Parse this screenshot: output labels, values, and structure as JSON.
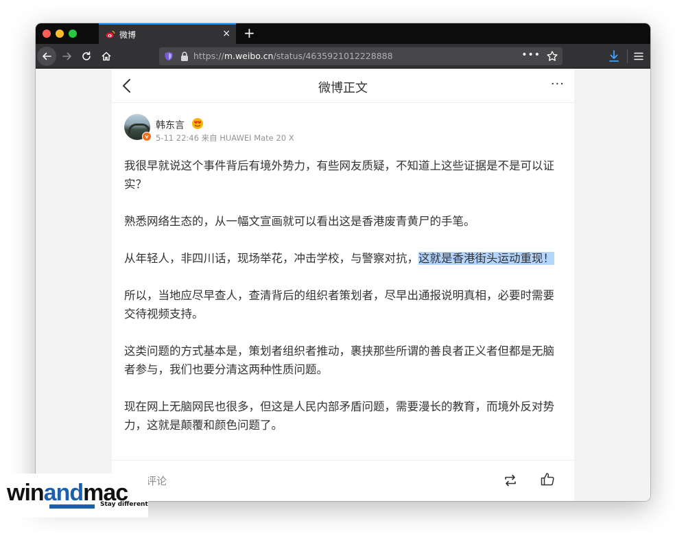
{
  "browser": {
    "tab": {
      "title": "微博",
      "favicon": "weibo-icon",
      "close": "×"
    },
    "new_tab": "+",
    "url": {
      "scheme": "https://",
      "host": "m.weibo.cn",
      "path": "/status/4635921012228888"
    },
    "url_more": "•••",
    "accent": "#0a84ff"
  },
  "page": {
    "header": {
      "title": "微博正文",
      "more": "···"
    },
    "author": {
      "name": "韩东言",
      "meta": "5-11 22:46 来自 HUAWEI Mate 20 X",
      "badge_color": "#f26f1b"
    },
    "paragraphs": [
      {
        "text": "我很早就说这个事件背后有境外势力，有些网友质疑，不知道上这些证据是不是可以证实？"
      },
      {
        "text": "熟悉网络生态的，从一幅文宣画就可以看出这是香港废青黄尸的手笔。"
      },
      {
        "before": "从年轻人，非四川话，现场举花，冲击学校，与警察对抗，",
        "highlight": "这就是香港街头运动重现！"
      },
      {
        "text": "所以，当地应尽早查人，查清背后的组织者策划者，尽早出通报说明真相，必要时需要交待视频支持。"
      },
      {
        "text": "这类问题的方式基本是，策划者组织者推动，裹挟那些所谓的善良者正义者但都是无脑者参与，我们也要分清这两种性质问题。"
      },
      {
        "text": "现在网上无脑网民也很多，但这是人民内部矛盾问题，需要漫长的教育，而境外反对势力，这就是颠覆和颜色问题了。"
      }
    ],
    "footer": {
      "comment_label": "评论"
    }
  },
  "watermark": {
    "part1": "win",
    "part2": "and",
    "part3": "mac",
    "tagline": "Stay different"
  }
}
